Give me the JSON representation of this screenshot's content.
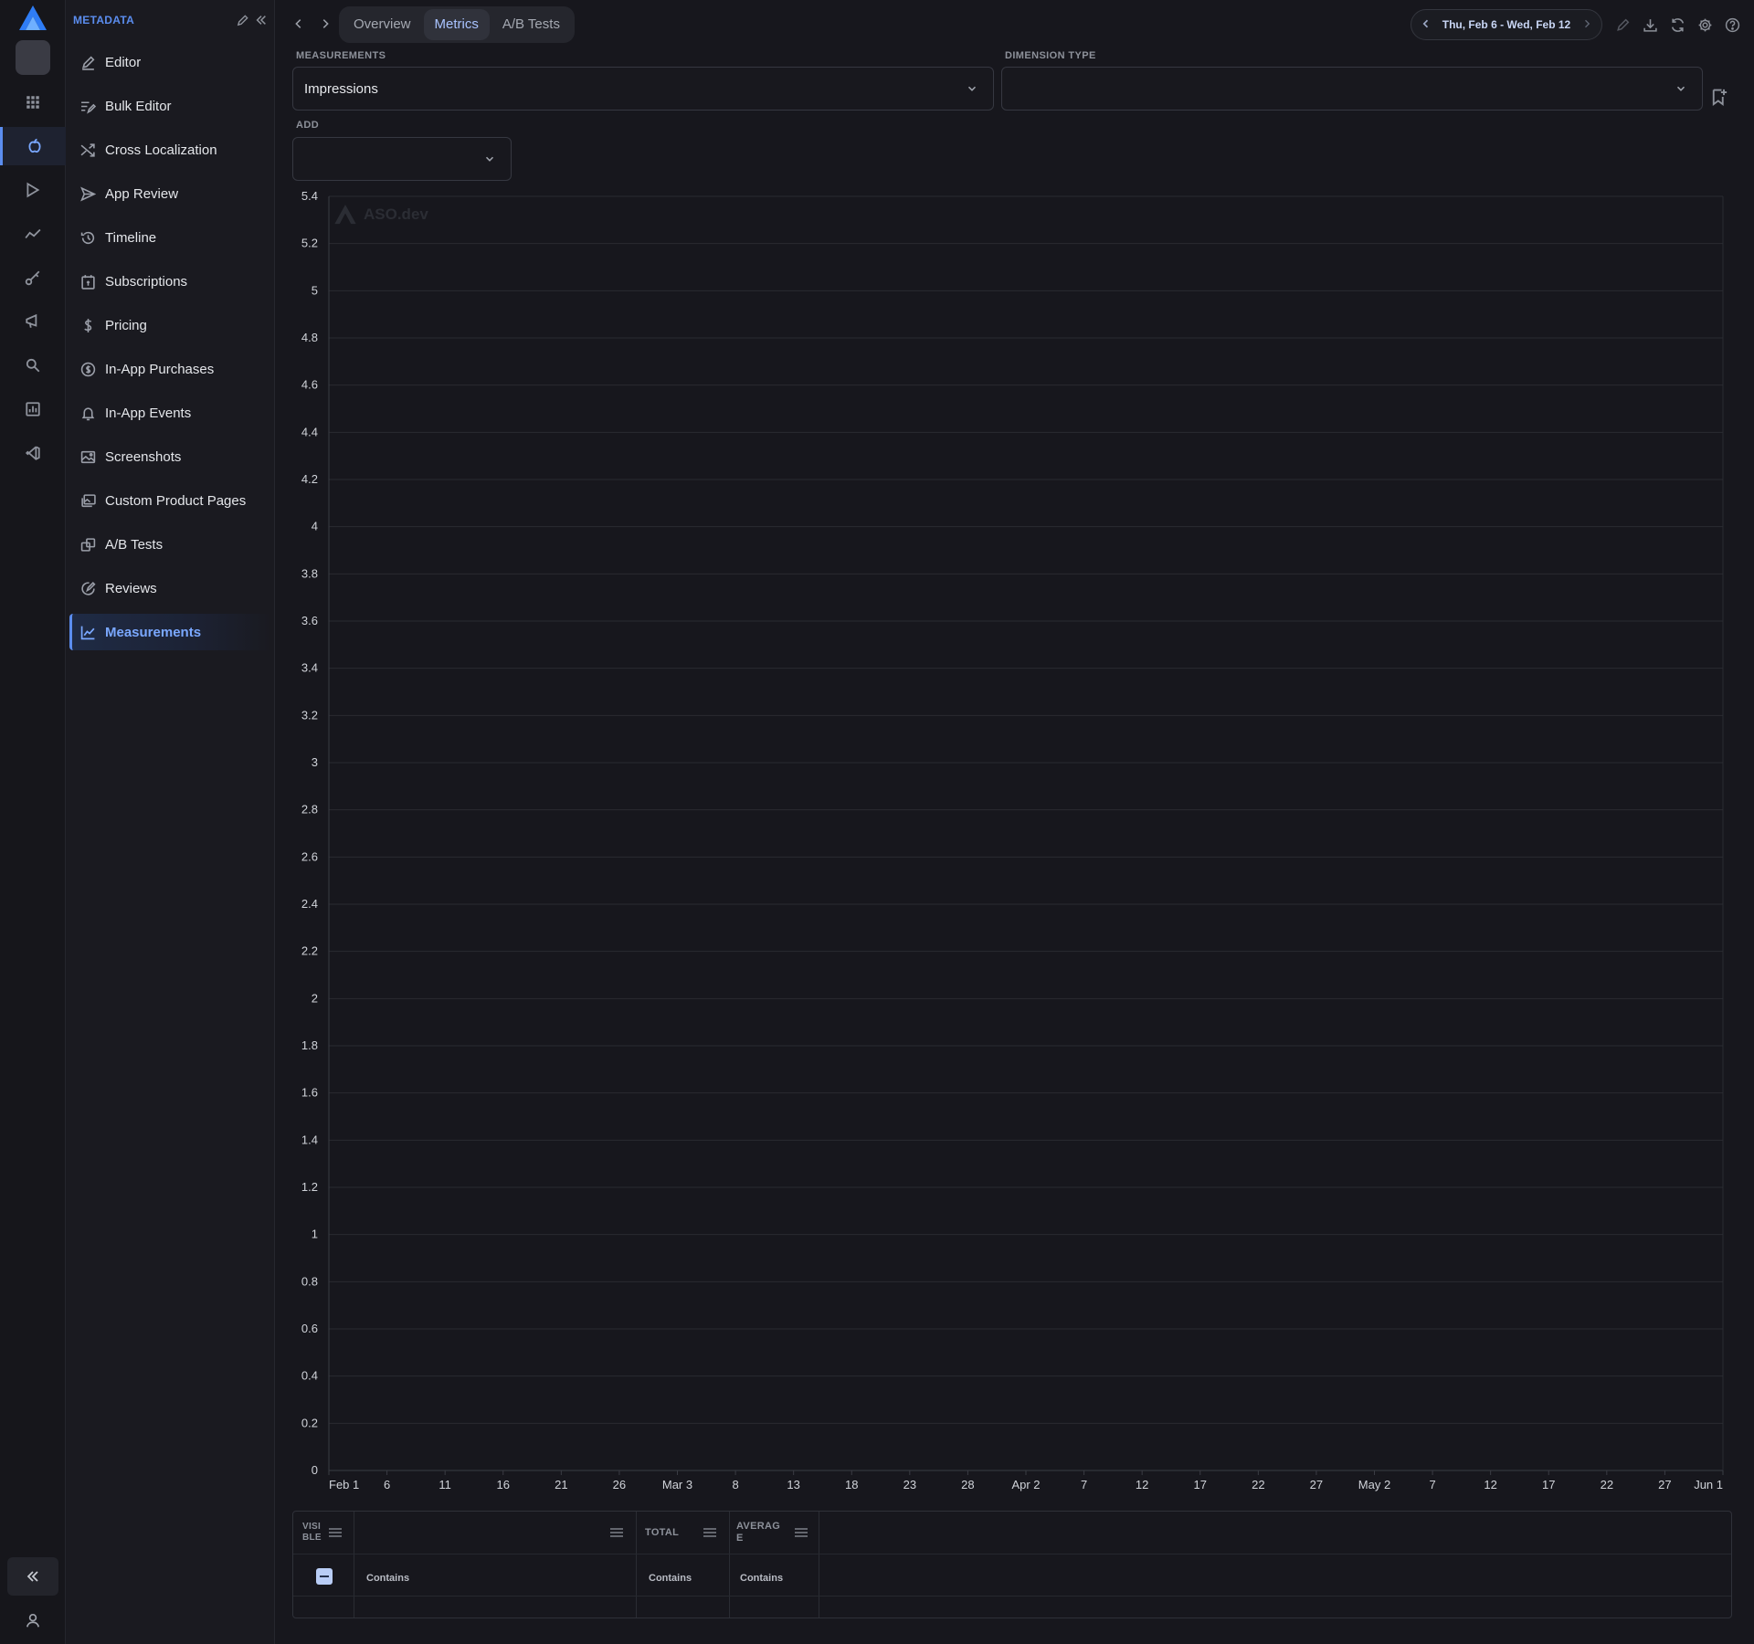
{
  "sidebar": {
    "title": "METADATA",
    "items": [
      {
        "label": "Editor",
        "icon": "pencil-icon"
      },
      {
        "label": "Bulk Editor",
        "icon": "bulk-edit-icon"
      },
      {
        "label": "Cross Localization",
        "icon": "shuffle-icon"
      },
      {
        "label": "App Review",
        "icon": "send-icon"
      },
      {
        "label": "Timeline",
        "icon": "history-icon"
      },
      {
        "label": "Subscriptions",
        "icon": "subscription-icon"
      },
      {
        "label": "Pricing",
        "icon": "dollar-icon"
      },
      {
        "label": "In-App Purchases",
        "icon": "coin-icon"
      },
      {
        "label": "In-App Events",
        "icon": "bell-icon"
      },
      {
        "label": "Screenshots",
        "icon": "image-icon"
      },
      {
        "label": "Custom Product Pages",
        "icon": "pages-icon"
      },
      {
        "label": "A/B Tests",
        "icon": "ab-test-icon"
      },
      {
        "label": "Reviews",
        "icon": "review-icon"
      },
      {
        "label": "Measurements",
        "icon": "chart-line-icon",
        "active": true
      }
    ]
  },
  "tabs": [
    {
      "label": "Overview"
    },
    {
      "label": "Metrics",
      "active": true
    },
    {
      "label": "A/B Tests"
    }
  ],
  "date_range": "Thu, Feb 6 - Wed, Feb 12",
  "form": {
    "measurements_label": "MEASUREMENTS",
    "measurements_value": "Impressions",
    "dimension_label": "DIMENSION TYPE",
    "dimension_value": "",
    "add_label": "ADD",
    "add_value": ""
  },
  "watermark": "ASO.dev",
  "chart_data": {
    "type": "line",
    "title": "",
    "xlabel": "",
    "ylabel": "",
    "ylim": [
      0,
      5.4
    ],
    "y_ticks": [
      "0",
      "0.2",
      "0.4",
      "0.6",
      "0.8",
      "1",
      "1.2",
      "1.4",
      "1.6",
      "1.8",
      "2",
      "2.2",
      "2.4",
      "2.6",
      "2.8",
      "3",
      "3.2",
      "3.4",
      "3.6",
      "3.8",
      "4",
      "4.2",
      "4.4",
      "4.6",
      "4.8",
      "5",
      "5.2",
      "5.4"
    ],
    "x_ticks": [
      "Feb 1",
      "6",
      "11",
      "16",
      "21",
      "26",
      "Mar 3",
      "8",
      "13",
      "18",
      "23",
      "28",
      "Apr 2",
      "7",
      "12",
      "17",
      "22",
      "27",
      "May 2",
      "7",
      "12",
      "17",
      "22",
      "27",
      "Jun 1"
    ],
    "grid": true,
    "series": []
  },
  "table": {
    "columns": [
      {
        "label": "VISIBLE"
      },
      {
        "label": ""
      },
      {
        "label": "TOTAL"
      },
      {
        "label": "AVERAGE"
      }
    ],
    "filter_text": "Contains"
  },
  "colors": {
    "accent": "#5b8def",
    "background": "#17171d",
    "grid": "#2a2b31"
  }
}
